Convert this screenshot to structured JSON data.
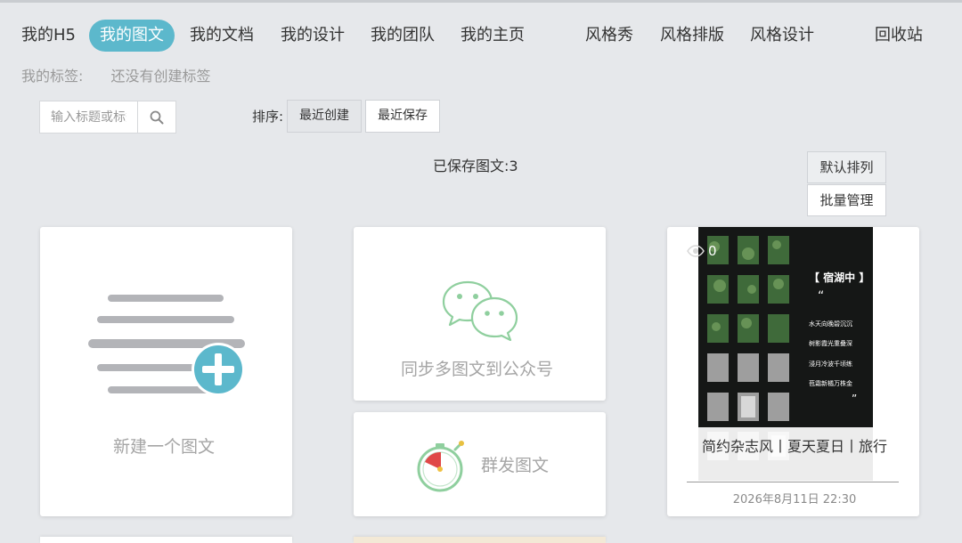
{
  "nav": {
    "items": [
      {
        "label": "我的H5"
      },
      {
        "label": "我的图文",
        "active": true
      },
      {
        "label": "我的文档"
      },
      {
        "label": "我的设计"
      },
      {
        "label": "我的团队"
      },
      {
        "label": "我的主页"
      },
      {
        "label": "风格秀"
      },
      {
        "label": "风格排版"
      },
      {
        "label": "风格设计"
      },
      {
        "label": "回收站"
      }
    ]
  },
  "tags": {
    "label": "我的标签:",
    "value": "还没有创建标签"
  },
  "search": {
    "placeholder": "输入标题或标签",
    "icon": "search-icon"
  },
  "sort": {
    "label": "排序:",
    "options": [
      "最近创建",
      "最近保存"
    ],
    "selected": "最近创建"
  },
  "saved_count": "已保存图文:3",
  "side_buttons": {
    "default_order": "默认排列",
    "batch_manage": "批量管理"
  },
  "cards": {
    "new": {
      "label": "新建一个图文",
      "icon": "new-article-icon"
    },
    "sync": {
      "label": "同步多图文到公众号",
      "icon": "wechat-icon"
    },
    "mass": {
      "label": "群发图文",
      "icon": "stopwatch-icon"
    },
    "item": {
      "views": "0",
      "title": "简约杂志风丨夏天夏日丨旅行",
      "date": "2026年8月11日 22:30",
      "thumb": {
        "title": "【 宿湖中 】",
        "quote_open": "“",
        "lines": [
          "水天向晚碧沉沉",
          "树影霞光重叠深",
          "浸月冷波千顷练",
          "苞霜新橘万株金"
        ],
        "quote_close": "”"
      }
    }
  },
  "colors": {
    "accent": "#5cb8cc",
    "wechat_green": "#8fcf9e",
    "background": "#e6e8eb"
  }
}
